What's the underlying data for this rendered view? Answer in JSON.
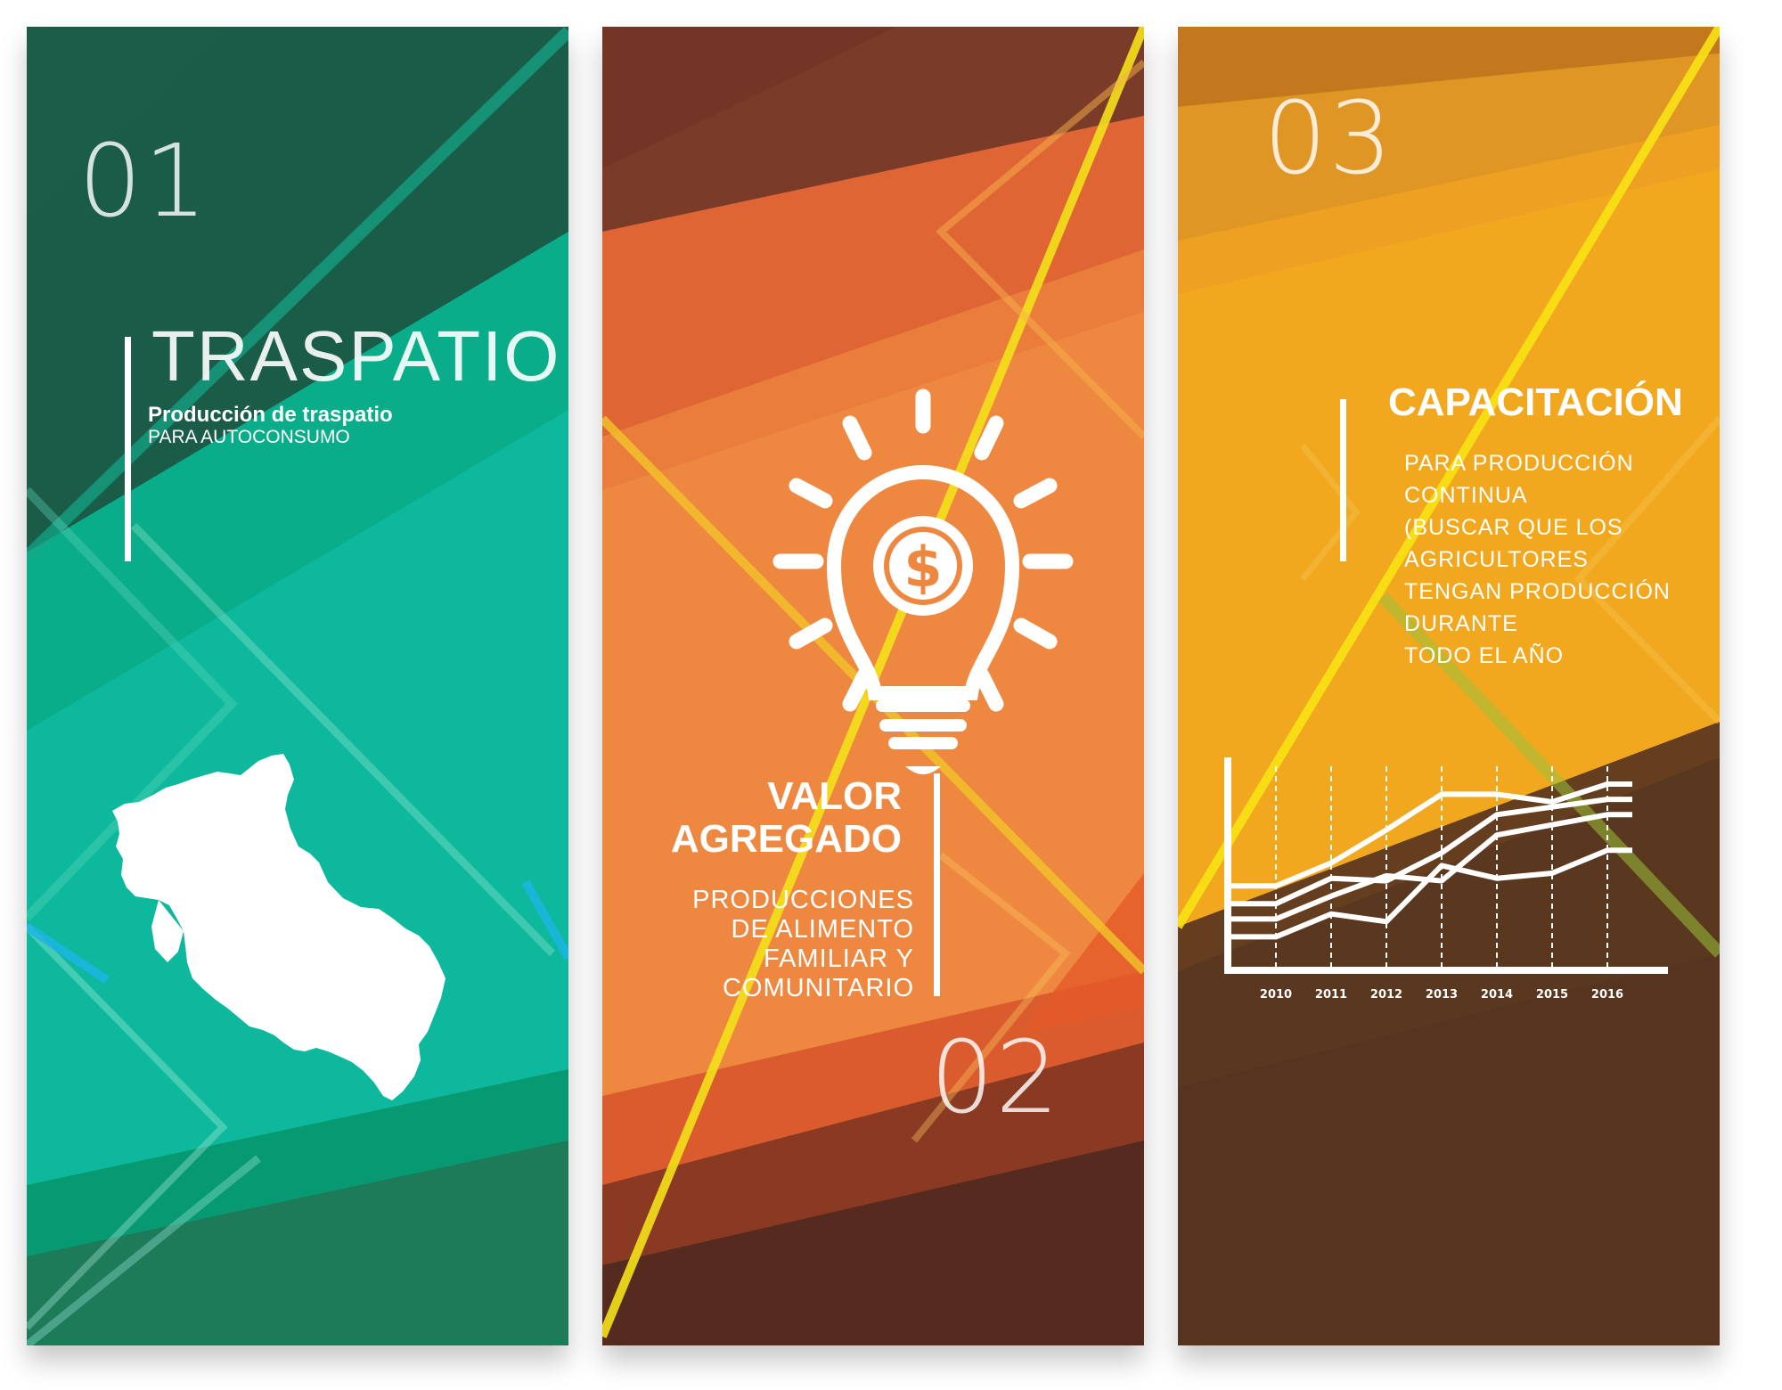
{
  "colors": {
    "green_dark": "#1b5c49",
    "green_mid": "#0aa882",
    "green_teal": "#0db89c",
    "orange_dark": "#7a3b28",
    "orange_mid": "#ee8840",
    "orange_deep": "#d7562b",
    "brown_dark": "#552a1f",
    "amber": "#f2a81e",
    "amber_dark": "#c4781e",
    "yellow_line": "#f4e11a",
    "brown_chart": "#5a371f",
    "white": "#ffffff"
  },
  "panels": [
    {
      "number": "01",
      "title": "TRASPATIO",
      "subtitle": "Producción de traspatio",
      "subtitle2": "PARA AUTOCONSUMO",
      "icon": "state-map-icon"
    },
    {
      "number": "02",
      "title_lines": [
        "VALOR",
        "AGREGADO"
      ],
      "body_lines": [
        "PRODUCCIONES",
        "DE ALIMENTO",
        "FAMILIAR Y",
        "COMUNITARIO"
      ],
      "icon": "lightbulb-dollar-icon"
    },
    {
      "number": "03",
      "title": "CAPACITACIÓN",
      "body_lines": [
        "PARA PRODUCCIÓN",
        "CONTINUA",
        "(BUSCAR QUE LOS",
        "AGRICULTORES",
        "TENGAN PRODUCCIÓN",
        "DURANTE",
        "TODO EL AÑO"
      ],
      "icon": "line-chart-icon"
    }
  ],
  "chart_data": {
    "type": "line",
    "x": [
      "2010",
      "2011",
      "2012",
      "2013",
      "2014",
      "2015",
      "2016"
    ],
    "series": [
      {
        "values": [
          3.0,
          3.9,
          5.2,
          6.6,
          6.6,
          6.3,
          7.0
        ]
      },
      {
        "values": [
          2.3,
          3.3,
          3.2,
          4.3,
          5.8,
          6.1,
          6.4
        ]
      },
      {
        "values": [
          1.7,
          2.6,
          3.4,
          3.2,
          5.0,
          5.4,
          5.8
        ]
      },
      {
        "values": [
          1.0,
          1.9,
          1.6,
          3.8,
          3.3,
          3.5,
          4.4
        ]
      }
    ],
    "grid": true,
    "legend": "none"
  }
}
